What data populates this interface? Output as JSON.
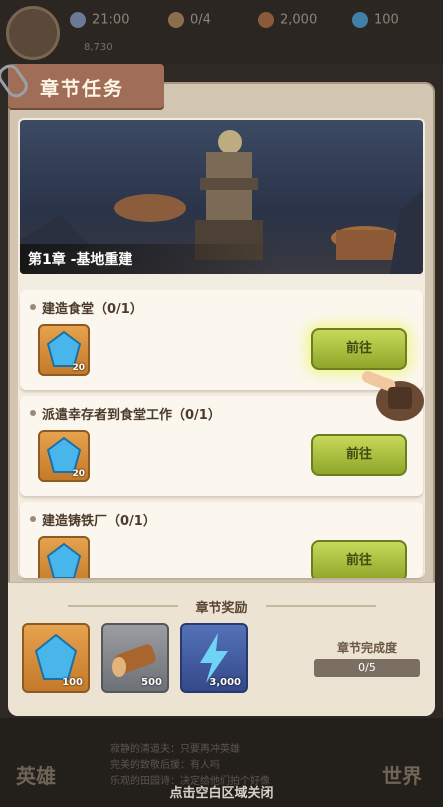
{
  "status_bar": {
    "time": "21:00",
    "units": "0/4",
    "wood": "2,000",
    "gems": "100",
    "power": "8,730"
  },
  "panel": {
    "title": "章节任务",
    "chapter_banner": "第1章 -基地重建"
  },
  "tasks": [
    {
      "name": "建造食堂（0/1）",
      "reward_count": "20",
      "button": "前往"
    },
    {
      "name": "派遣幸存者到食堂工作（0/1）",
      "reward_count": "20",
      "button": "前往"
    },
    {
      "name": "建造铸铁厂（0/1）",
      "reward_count": "",
      "button": "前往"
    }
  ],
  "chapter_reward": {
    "title": "章节奖励",
    "items": [
      {
        "icon": "gem-icon",
        "count": "100"
      },
      {
        "icon": "log-icon",
        "count": "500"
      },
      {
        "icon": "lightning-icon",
        "count": "3,000"
      }
    ],
    "progress_label": "章节完成度",
    "progress_value": "0/5"
  },
  "bottom": {
    "left_nav": "英雄",
    "right_nav": "世界",
    "news_lines": [
      "寂静的清道夫：只要再冲英雄",
      "完美的致敬后援：有人吗",
      "乐观的田园诗：决定给他们拍个好像"
    ],
    "close_hint": "点击空白区域关闭"
  },
  "colors": {
    "panel_bg": "#d2c6b3",
    "card_bg": "#fbf7ef",
    "button_green": "#a9c03c",
    "title_tab": "#a06e56"
  }
}
